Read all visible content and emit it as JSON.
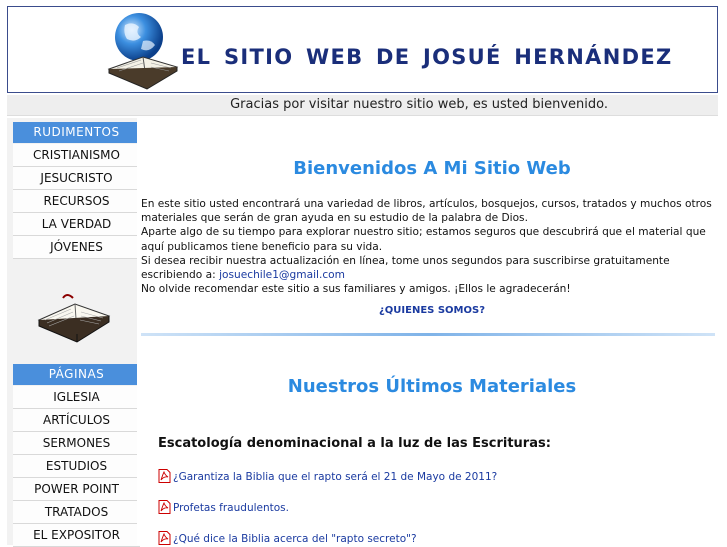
{
  "header": {
    "site_title": "EL SITIO WEB DE JOSUÉ HERNÁNDEZ"
  },
  "welcome_bar": {
    "text": "Gracias por visitar nuestro sitio web, es usted bienvenido."
  },
  "sidebar": {
    "section1_title": "RUDIMENTOS",
    "section1_items": [
      "CRISTIANISMO",
      "JESUCRISTO",
      "RECURSOS",
      "LA VERDAD",
      "JÓVENES"
    ],
    "section2_title": "PÁGINAS",
    "section2_items": [
      "IGLESIA",
      "ARTÍCULOS",
      "SERMONES",
      "ESTUDIOS",
      "POWER POINT",
      "TRATADOS",
      "EL EXPOSITOR"
    ]
  },
  "main": {
    "welcome_title": "Bienvenidos A Mi Sitio Web",
    "intro_p1": "En este sitio usted encontrará una variedad de libros, artículos, bosquejos, cursos, tratados y muchos otros materiales que serán de gran ayuda en su estudio de la palabra de Dios.",
    "intro_p2": "Aparte algo de su tiempo para explorar nuestro sitio; estamos seguros que descubrirá que el material que aquí publicamos tiene beneficio para su vida.",
    "intro_p3": "Si desea recibir nuestra actualización en línea, tome unos segundos para suscribirse gratuitamente escribiendo a:",
    "email": "josuechile1@gmail.com",
    "intro_p4": "No olvide recomendar este sitio a sus familiares y amigos. ¡Ellos le agradecerán!",
    "quienes_link": "¿QUIENES SOMOS?",
    "materials_title": "Nuestros Últimos Materiales",
    "materials_subheading": "Escatología denominacional a la luz de las Escrituras:",
    "materials": [
      "¿Garantiza la Biblia que el rapto será el 21 de Mayo de 2011?",
      "Profetas fraudulentos.",
      "¿Qué dice la Biblia acerca del \"rapto secreto\"?"
    ]
  },
  "colors": {
    "accent_blue": "#4a8fdc",
    "title_blue": "#2b8ae0",
    "link_blue": "#1a3aa0",
    "header_navy": "#1a2e7a"
  },
  "icons": {
    "logo": "globe-bible-icon",
    "sidebar_image": "open-bible-icon",
    "material_icon": "pdf-icon"
  }
}
